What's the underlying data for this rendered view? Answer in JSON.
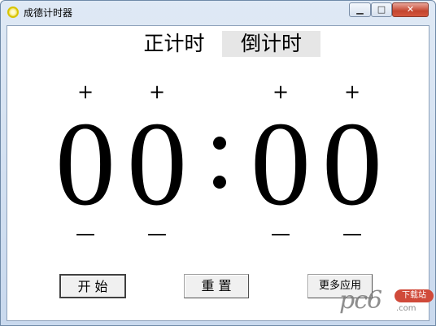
{
  "window": {
    "title": "成德计时器",
    "controls": {
      "minimize": "▁",
      "maximize": "□",
      "close": "✕"
    }
  },
  "modes": {
    "count_up": "正计时",
    "count_down": "倒计时",
    "selected": "count_down"
  },
  "timer": {
    "minutes_tens": "0",
    "minutes_ones": "0",
    "seconds_tens": "0",
    "seconds_ones": "0",
    "increment": "+",
    "decrement": "—"
  },
  "buttons": {
    "start": "开 始",
    "reset": "重 置",
    "more_apps": "更多应用"
  },
  "watermark": {
    "logo": "pc6",
    "badge": "下载站",
    "url": ".com"
  },
  "icons": {
    "app": "stopwatch-icon"
  }
}
